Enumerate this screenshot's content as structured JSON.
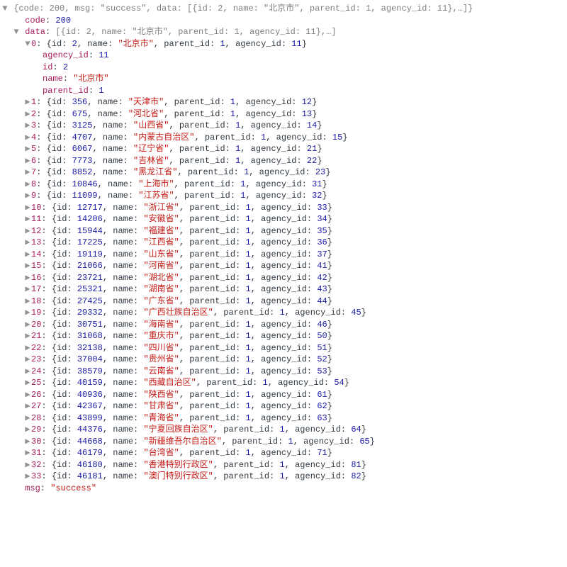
{
  "root_preview_prefix": "{code: 200, msg: \"success\", data: [{id: 2, name: \"北京市\", parent_id: 1, agency_id: 11},…]}",
  "code_key": "code",
  "code_val": 200,
  "data_key": "data",
  "data_preview": "[{id: 2, name: \"北京市\", parent_id: 1, agency_id: 11},…]",
  "expanded_index": 0,
  "expanded_props": {
    "agency_id_key": "agency_id",
    "agency_id_val": 11,
    "id_key": "id",
    "id_val": 2,
    "name_key": "name",
    "name_val": "北京市",
    "parent_id_key": "parent_id",
    "parent_id_val": 1
  },
  "items": [
    {
      "idx": 0,
      "id": 2,
      "name": "北京市",
      "parent_id": 1,
      "agency_id": 11
    },
    {
      "idx": 1,
      "id": 356,
      "name": "天津市",
      "parent_id": 1,
      "agency_id": 12
    },
    {
      "idx": 2,
      "id": 675,
      "name": "河北省",
      "parent_id": 1,
      "agency_id": 13
    },
    {
      "idx": 3,
      "id": 3125,
      "name": "山西省",
      "parent_id": 1,
      "agency_id": 14
    },
    {
      "idx": 4,
      "id": 4707,
      "name": "内蒙古自治区",
      "parent_id": 1,
      "agency_id": 15
    },
    {
      "idx": 5,
      "id": 6067,
      "name": "辽宁省",
      "parent_id": 1,
      "agency_id": 21
    },
    {
      "idx": 6,
      "id": 7773,
      "name": "吉林省",
      "parent_id": 1,
      "agency_id": 22
    },
    {
      "idx": 7,
      "id": 8852,
      "name": "黑龙江省",
      "parent_id": 1,
      "agency_id": 23
    },
    {
      "idx": 8,
      "id": 10846,
      "name": "上海市",
      "parent_id": 1,
      "agency_id": 31
    },
    {
      "idx": 9,
      "id": 11099,
      "name": "江苏省",
      "parent_id": 1,
      "agency_id": 32
    },
    {
      "idx": 10,
      "id": 12717,
      "name": "浙江省",
      "parent_id": 1,
      "agency_id": 33
    },
    {
      "idx": 11,
      "id": 14206,
      "name": "安徽省",
      "parent_id": 1,
      "agency_id": 34
    },
    {
      "idx": 12,
      "id": 15944,
      "name": "福建省",
      "parent_id": 1,
      "agency_id": 35
    },
    {
      "idx": 13,
      "id": 17225,
      "name": "江西省",
      "parent_id": 1,
      "agency_id": 36
    },
    {
      "idx": 14,
      "id": 19119,
      "name": "山东省",
      "parent_id": 1,
      "agency_id": 37
    },
    {
      "idx": 15,
      "id": 21066,
      "name": "河南省",
      "parent_id": 1,
      "agency_id": 41
    },
    {
      "idx": 16,
      "id": 23721,
      "name": "湖北省",
      "parent_id": 1,
      "agency_id": 42
    },
    {
      "idx": 17,
      "id": 25321,
      "name": "湖南省",
      "parent_id": 1,
      "agency_id": 43
    },
    {
      "idx": 18,
      "id": 27425,
      "name": "广东省",
      "parent_id": 1,
      "agency_id": 44
    },
    {
      "idx": 19,
      "id": 29332,
      "name": "广西壮族自治区",
      "parent_id": 1,
      "agency_id": 45
    },
    {
      "idx": 20,
      "id": 30751,
      "name": "海南省",
      "parent_id": 1,
      "agency_id": 46
    },
    {
      "idx": 21,
      "id": 31068,
      "name": "重庆市",
      "parent_id": 1,
      "agency_id": 50
    },
    {
      "idx": 22,
      "id": 32138,
      "name": "四川省",
      "parent_id": 1,
      "agency_id": 51
    },
    {
      "idx": 23,
      "id": 37004,
      "name": "贵州省",
      "parent_id": 1,
      "agency_id": 52
    },
    {
      "idx": 24,
      "id": 38579,
      "name": "云南省",
      "parent_id": 1,
      "agency_id": 53
    },
    {
      "idx": 25,
      "id": 40159,
      "name": "西藏自治区",
      "parent_id": 1,
      "agency_id": 54
    },
    {
      "idx": 26,
      "id": 40936,
      "name": "陕西省",
      "parent_id": 1,
      "agency_id": 61
    },
    {
      "idx": 27,
      "id": 42367,
      "name": "甘肃省",
      "parent_id": 1,
      "agency_id": 62
    },
    {
      "idx": 28,
      "id": 43899,
      "name": "青海省",
      "parent_id": 1,
      "agency_id": 63
    },
    {
      "idx": 29,
      "id": 44376,
      "name": "宁夏回族自治区",
      "parent_id": 1,
      "agency_id": 64
    },
    {
      "idx": 30,
      "id": 44668,
      "name": "新疆维吾尔自治区",
      "parent_id": 1,
      "agency_id": 65
    },
    {
      "idx": 31,
      "id": 46179,
      "name": "台湾省",
      "parent_id": 1,
      "agency_id": 71
    },
    {
      "idx": 32,
      "id": 46180,
      "name": "香港特别行政区",
      "parent_id": 1,
      "agency_id": 81
    },
    {
      "idx": 33,
      "id": 46181,
      "name": "澳门特别行政区",
      "parent_id": 1,
      "agency_id": 82
    }
  ],
  "msg_key": "msg",
  "msg_val": "success"
}
